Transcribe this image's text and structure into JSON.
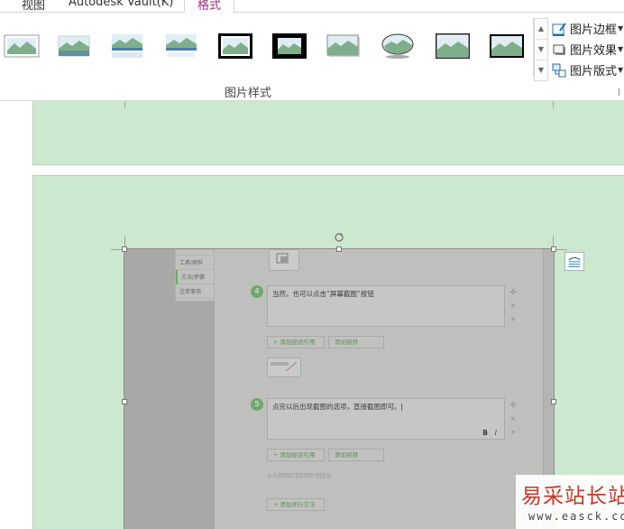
{
  "tabs": [
    {
      "label": "视图",
      "active": false
    },
    {
      "label": "Autodesk Vault(K)",
      "active": false
    },
    {
      "label": "格式",
      "active": true
    }
  ],
  "ribbon": {
    "group_label": "图片样式",
    "picture_styles": [
      {
        "icon": "simple-frame-white-style-icon"
      },
      {
        "icon": "soft-edge-rectangle-style-icon"
      },
      {
        "icon": "reflected-rectangle-style-icon"
      },
      {
        "icon": "reflected-soft-edge-style-icon"
      },
      {
        "icon": "thick-black-frame-style-icon"
      },
      {
        "icon": "black-matte-frame-style-icon"
      },
      {
        "icon": "center-shadow-rectangle-style-icon"
      },
      {
        "icon": "oval-reflected-style-icon"
      },
      {
        "icon": "double-frame-black-style-icon"
      },
      {
        "icon": "thin-black-frame-style-icon"
      }
    ],
    "commands": [
      {
        "label": "图片边框",
        "icon": "picture-border-icon"
      },
      {
        "label": "图片效果",
        "icon": "picture-effects-icon"
      },
      {
        "label": "图片版式",
        "icon": "picture-layout-icon"
      }
    ]
  },
  "screenshot": {
    "nav_items": [
      "工具/原料",
      "方法/步骤",
      "注意事项"
    ],
    "steps": [
      {
        "number": "4",
        "text": "当然，也可以点击“屏幕截图”按钮"
      },
      {
        "number": "5",
        "text": "点完以后出现截图的选项，直接截图即可。"
      }
    ],
    "add_reference_label": "+ 添加经验引用",
    "add_video_label": "添加视频",
    "add_method_label": "+ 添加并行方法",
    "hint_text": "从右侧图库添加图片到此处",
    "format_icons": [
      "B",
      "I"
    ]
  },
  "watermark": {
    "cn": "易采站长站",
    "en": "www.easck.com"
  },
  "colors": {
    "page_green": "#cce8cf",
    "active_tab": "#9b2f84",
    "watermark_red": "#c0392b"
  }
}
